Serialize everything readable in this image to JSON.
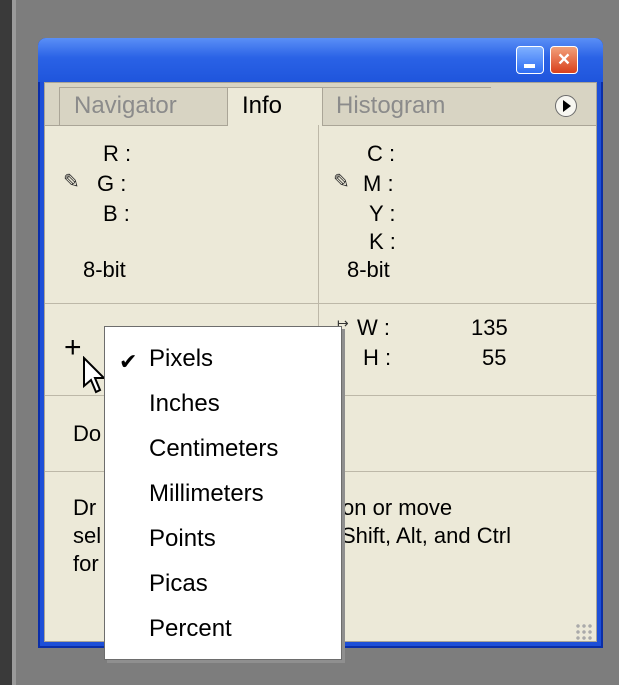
{
  "tabs": [
    {
      "label": "Navigator"
    },
    {
      "label": "Info"
    },
    {
      "label": "Histogram"
    }
  ],
  "rgb": {
    "r": "R :",
    "g": "G :",
    "b": "B :",
    "depth": "8-bit"
  },
  "cmyk": {
    "c": "C :",
    "m": "M :",
    "y": "Y :",
    "k": "K :",
    "depth": "8-bit"
  },
  "size": {
    "w_label": "W :",
    "w_value": "135",
    "h_label": "H :",
    "h_value": "55"
  },
  "doc_partial": "Do",
  "status": {
    "left_lines": [
      "Dr",
      "sel",
      "for"
    ],
    "right_lines": [
      "tion or move",
      "Shift, Alt, and Ctrl"
    ]
  },
  "units_menu": {
    "selected": "Pixels",
    "items": [
      "Pixels",
      "Inches",
      "Centimeters",
      "Millimeters",
      "Points",
      "Picas",
      "Percent"
    ]
  },
  "icons": {
    "eyedropper": "eyedropper-icon",
    "crosshair": "crosshair-icon",
    "palette_menu": "palette-menu-icon",
    "close": "close-icon",
    "minimize": "minimize-icon"
  }
}
